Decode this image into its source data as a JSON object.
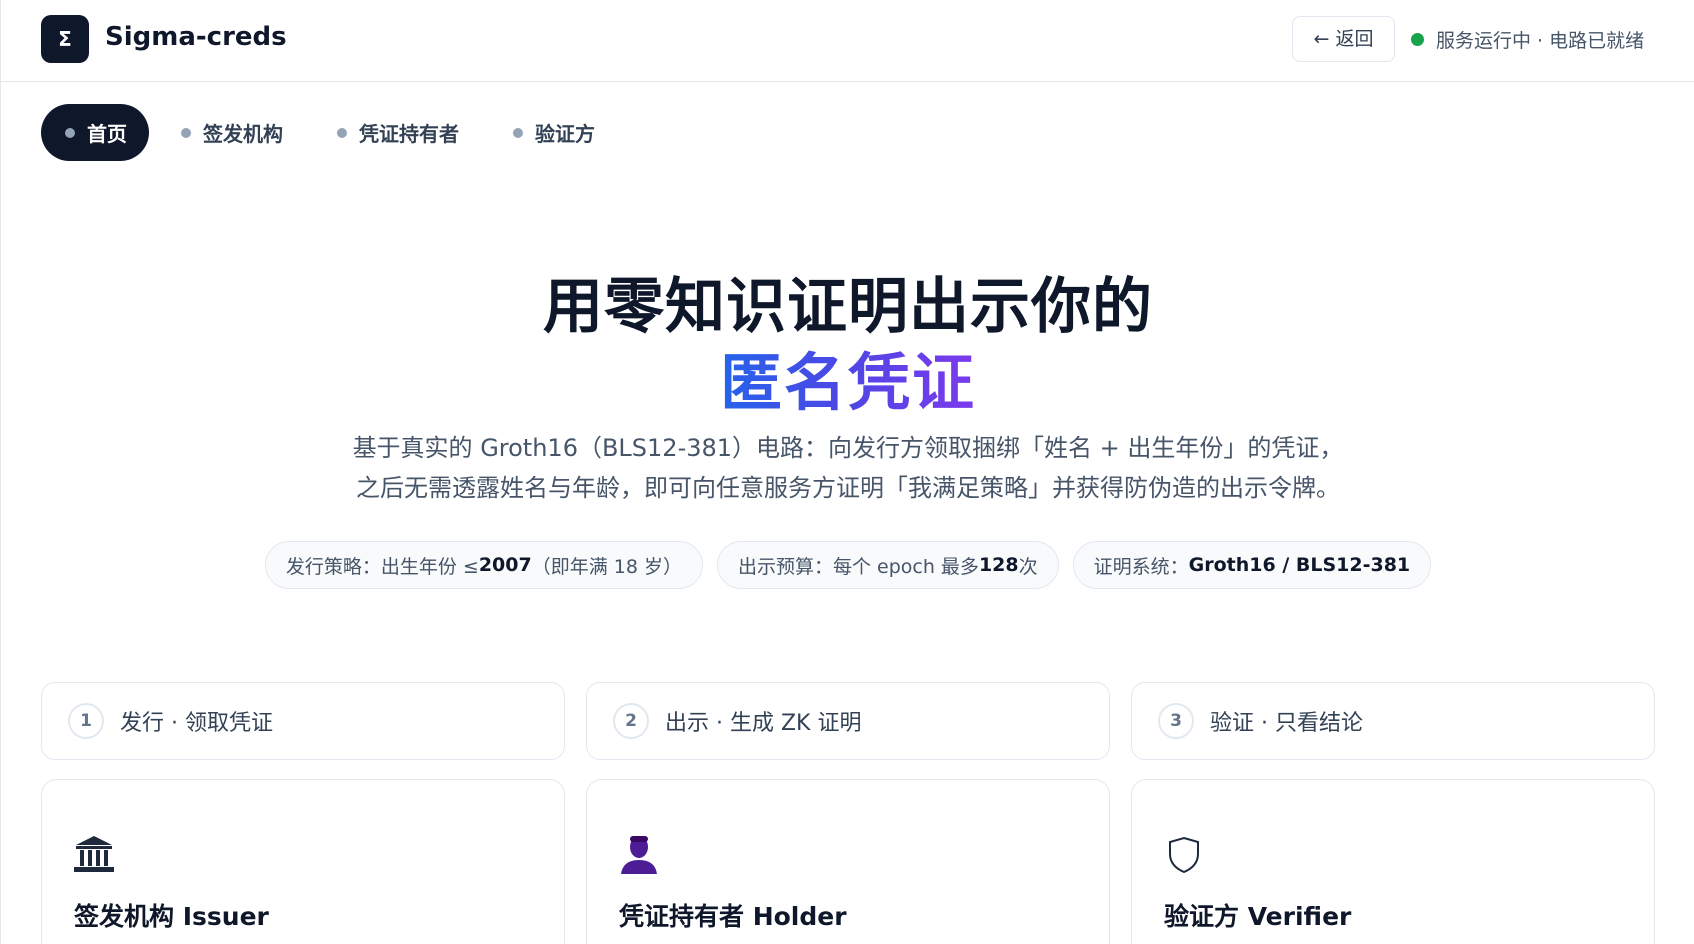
{
  "header": {
    "logo_symbol": "Σ",
    "brand": "Sigma-creds",
    "back_label": "← 返回",
    "status_text": "服务运行中 · 电路已就绪",
    "status_color": "#16a34a"
  },
  "nav": {
    "items": [
      {
        "label": "首页",
        "active": true
      },
      {
        "label": "签发机构",
        "active": false
      },
      {
        "label": "凭证持有者",
        "active": false
      },
      {
        "label": "验证方",
        "active": false
      }
    ]
  },
  "hero": {
    "title": "用零知识证明出示你的",
    "accent": "匿名凭证",
    "desc_line1": "基于真实的 Groth16（BLS12-381）电路：向发行方领取捆绑「姓名 + 出生年份」的凭证，",
    "desc_line2": "之后无需透露姓名与年龄，即可向任意服务方证明「我满足策略」并获得防伪造的出示令牌。"
  },
  "chips": [
    {
      "prefix": "发行策略：出生年份 ≤ ",
      "value": "2007",
      "suffix": "（即年满 18 岁）"
    },
    {
      "prefix": "出示预算：每个 epoch 最多 ",
      "value": "128",
      "suffix": " 次"
    },
    {
      "prefix": "证明系统：",
      "value": "Groth16 / BLS12-381",
      "suffix": ""
    }
  ],
  "steps": [
    {
      "num": "1",
      "label": "发行 · 领取凭证"
    },
    {
      "num": "2",
      "label": "出示 · 生成 ZK 证明"
    },
    {
      "num": "3",
      "label": "验证 · 只看结论"
    }
  ],
  "cards": [
    {
      "icon": "bank-icon",
      "title": "签发机构 Issuer"
    },
    {
      "icon": "person-icon",
      "title": "凭证持有者 Holder"
    },
    {
      "icon": "shield-icon",
      "title": "验证方 Verifier"
    }
  ]
}
